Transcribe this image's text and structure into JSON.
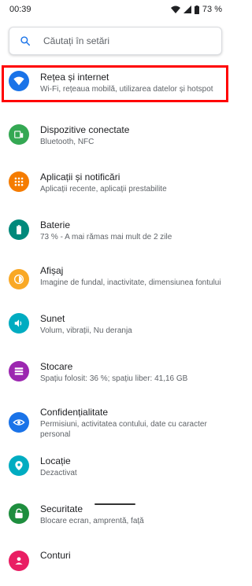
{
  "status_bar": {
    "time": "00:39",
    "battery_percent": "73 %"
  },
  "search": {
    "placeholder": "Căutați în setări"
  },
  "items": [
    {
      "title": "Rețea și internet",
      "subtitle": "Wi-Fi, rețeaua mobilă, utilizarea datelor și hotspot",
      "icon": "wifi-icon",
      "color": "#1a73e8"
    },
    {
      "title": "Dispozitive conectate",
      "subtitle": "Bluetooth, NFC",
      "icon": "devices-icon",
      "color": "#34a853"
    },
    {
      "title": "Aplicații și notificări",
      "subtitle": "Aplicații recente, aplicații prestabilite",
      "icon": "apps-icon",
      "color": "#f57c00"
    },
    {
      "title": "Baterie",
      "subtitle": "73 % - A mai rămas mai mult de 2 zile",
      "icon": "battery-icon",
      "color": "#00897b"
    },
    {
      "title": "Afișaj",
      "subtitle": "Imagine de fundal, inactivitate, dimensiunea fontului",
      "icon": "brightness-icon",
      "color": "#f9a825"
    },
    {
      "title": "Sunet",
      "subtitle": "Volum, vibrații, Nu deranja",
      "icon": "volume-icon",
      "color": "#00acc1"
    },
    {
      "title": "Stocare",
      "subtitle": "Spațiu folosit: 36 %; spațiu liber: 41,16 GB",
      "icon": "storage-icon",
      "color": "#9c27b0"
    },
    {
      "title": "Confidențialitate",
      "subtitle": "Permisiuni, activitatea contului, date cu caracter personal",
      "icon": "privacy-eye-icon",
      "color": "#1a73e8"
    },
    {
      "title": "Locație",
      "subtitle": "Dezactivat",
      "icon": "location-icon",
      "color": "#00acc1"
    },
    {
      "title": "Securitate",
      "subtitle": "Blocare ecran, amprentă, față",
      "icon": "lock-icon",
      "color": "#1e8e3e"
    },
    {
      "title": "Conturi",
      "subtitle": "",
      "icon": "account-icon",
      "color": "#e91e63"
    }
  ]
}
